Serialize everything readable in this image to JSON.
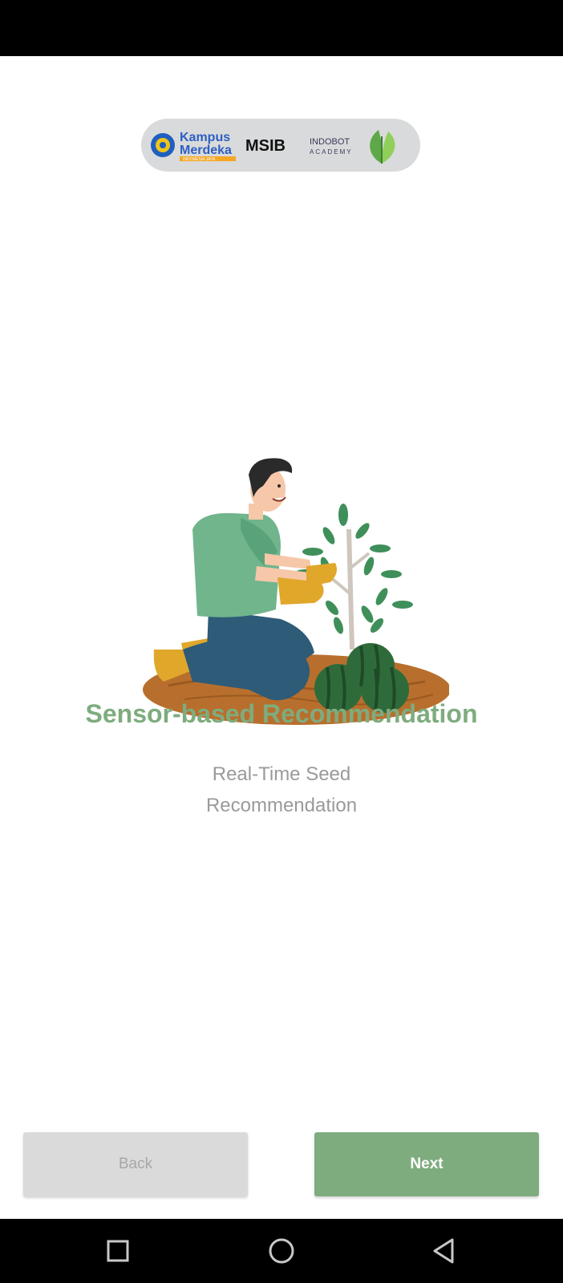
{
  "header": {
    "logos": [
      {
        "icon": "tut-wuri-icon",
        "text_line1": "Kampus",
        "text_line2": "Merdeka",
        "tagline": "INDONESIA JAYA"
      },
      {
        "text": "MSIB"
      },
      {
        "text_line1": "INDOBOT",
        "text_line2": "ACADEMY"
      },
      {
        "icon": "leaf-icon"
      }
    ]
  },
  "onboarding": {
    "title": "Sensor-based Recommendation",
    "subtitle": "Real-Time Seed Recommendation"
  },
  "buttons": {
    "back_label": "Back",
    "next_label": "Next"
  },
  "navigation": {
    "recents": "square-recents-icon",
    "home": "circle-home-icon",
    "back": "triangle-back-icon"
  },
  "colors": {
    "accent": "#7EAC7E",
    "disabled": "#DADADA",
    "subtitle": "#9A9A9A"
  }
}
